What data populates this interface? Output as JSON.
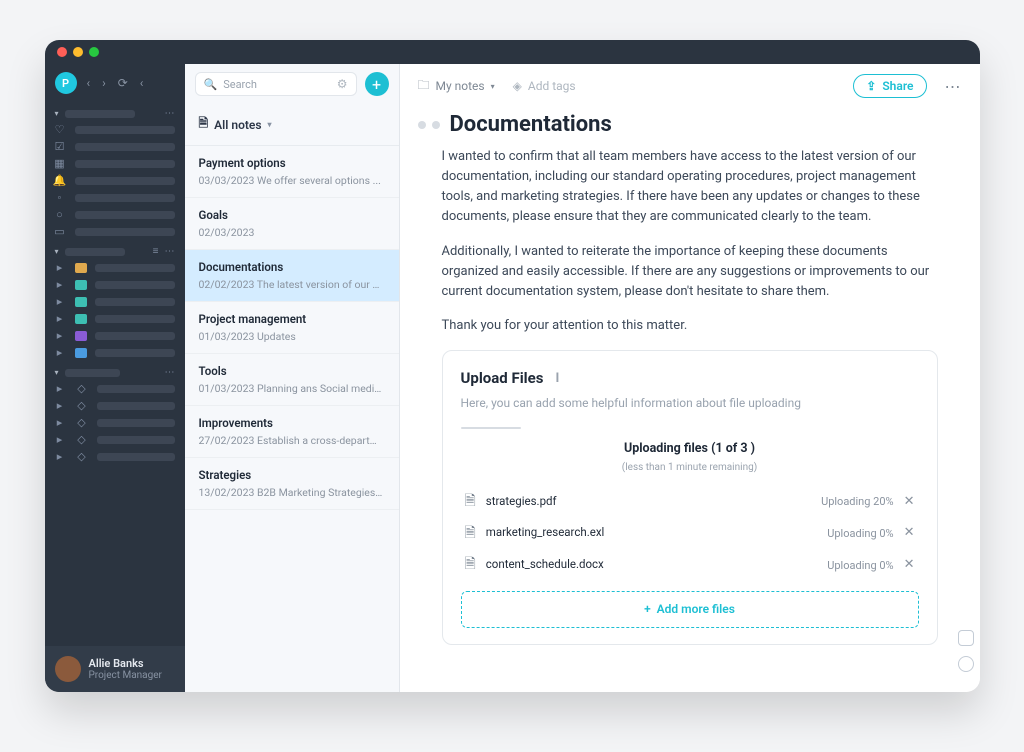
{
  "window": {
    "avatar_letter": "P"
  },
  "sidebar": {
    "user": {
      "name": "Allie Banks",
      "role": "Project Manager"
    }
  },
  "search": {
    "placeholder": "Search"
  },
  "noteList": {
    "header": "All notes",
    "items": [
      {
        "title": "Payment options",
        "date": "03/03/2023",
        "snippet": "We offer several options ..."
      },
      {
        "title": "Goals",
        "date": "02/03/2023",
        "snippet": ""
      },
      {
        "title": "Documentations",
        "date": "02/02/2023",
        "snippet": "The latest version of our doc..."
      },
      {
        "title": "Project management",
        "date": "01/03/2023",
        "snippet": "Updates"
      },
      {
        "title": "Tools",
        "date": "01/03/2023",
        "snippet": "Planning ans Social media ..."
      },
      {
        "title": "Improvements",
        "date": "27/02/2023",
        "snippet": "Establish a cross-department ..."
      },
      {
        "title": "Strategies",
        "date": "13/02/2023",
        "snippet": "B2B Marketing Strategies ..."
      }
    ]
  },
  "header": {
    "breadcrumb_label": "My notes",
    "add_tags": "Add tags",
    "share": "Share"
  },
  "doc": {
    "title": "Documentations",
    "p1": "I wanted to confirm that all team members have access to the latest version of our documentation, including our standard operating procedures, project management tools, and marketing strategies. If there have been any updates or changes to these documents, please ensure that they are communicated clearly to the team.",
    "p2": "Additionally, I wanted to reiterate the importance of keeping these documents organized and easily accessible. If there are any suggestions or improvements to our current documentation system, please don't hesitate to share them.",
    "p3": "Thank you for your attention to this matter."
  },
  "upload": {
    "title": "Upload Files",
    "subtitle": "Here, you can add some helpful information about file uploading",
    "heading": "Uploading files (1 of 3 )",
    "heading_sub": "(less than 1 minute remaining)",
    "files": [
      {
        "name": "strategies.pdf",
        "status": "Uploading 20%"
      },
      {
        "name": "marketing_research.exl",
        "status": "Uploading 0%"
      },
      {
        "name": "content_schedule.docx",
        "status": "Uploading 0%"
      }
    ],
    "add_more": "Add more files"
  }
}
